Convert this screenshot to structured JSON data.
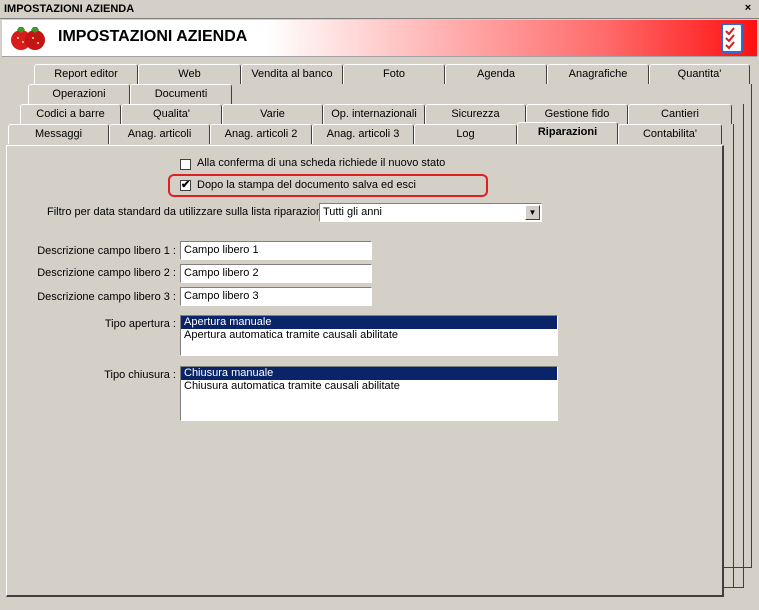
{
  "window": {
    "title": "IMPOSTAZIONI AZIENDA",
    "close_label": "×"
  },
  "header": {
    "title": "IMPOSTAZIONI AZIENDA"
  },
  "tabs_row1": [
    "Report editor",
    "Web",
    "Vendita al banco",
    "Foto",
    "Agenda",
    "Anagrafiche",
    "Quantita'"
  ],
  "tabs_row2": [
    "Operazioni",
    "Documenti"
  ],
  "tabs_row3": [
    "Codici a barre",
    "Qualita'",
    "Varie",
    "Op. internazionali",
    "Sicurezza",
    "Gestione fido",
    "Cantieri"
  ],
  "tabs_row4": [
    "Messaggi",
    "Anag. articoli",
    "Anag. articoli 2",
    "Anag. articoli 3",
    "Log",
    "Riparazioni",
    "Contabilita'"
  ],
  "active_tab": "Riparazioni",
  "options": {
    "confirm_new_state": {
      "label": "Alla conferma di una scheda richiede il nuovo stato",
      "checked": false
    },
    "save_exit_after_print": {
      "label": "Dopo la stampa del documento salva ed esci",
      "checked": true
    }
  },
  "date_filter": {
    "label": "Filtro per data standard da utilizzare sulla lista riparazioni :",
    "value": "Tutti gli anni"
  },
  "free_fields": [
    {
      "label": "Descrizione campo libero 1 :",
      "value": "Campo libero 1"
    },
    {
      "label": "Descrizione campo libero 2 :",
      "value": "Campo libero 2"
    },
    {
      "label": "Descrizione campo libero 3 :",
      "value": "Campo libero 3"
    }
  ],
  "tipo_apertura": {
    "label": "Tipo apertura :",
    "items": [
      "Apertura manuale",
      "Apertura automatica tramite causali abilitate"
    ],
    "selected": "Apertura manuale"
  },
  "tipo_chiusura": {
    "label": "Tipo chiusura :",
    "items": [
      "Chiusura manuale",
      "Chiusura automatica tramite causali abilitate"
    ],
    "selected": "Chiusura manuale"
  },
  "colors": {
    "selection": "#0a246a",
    "highlight": "#e02020",
    "header_red": "#ff1010"
  }
}
